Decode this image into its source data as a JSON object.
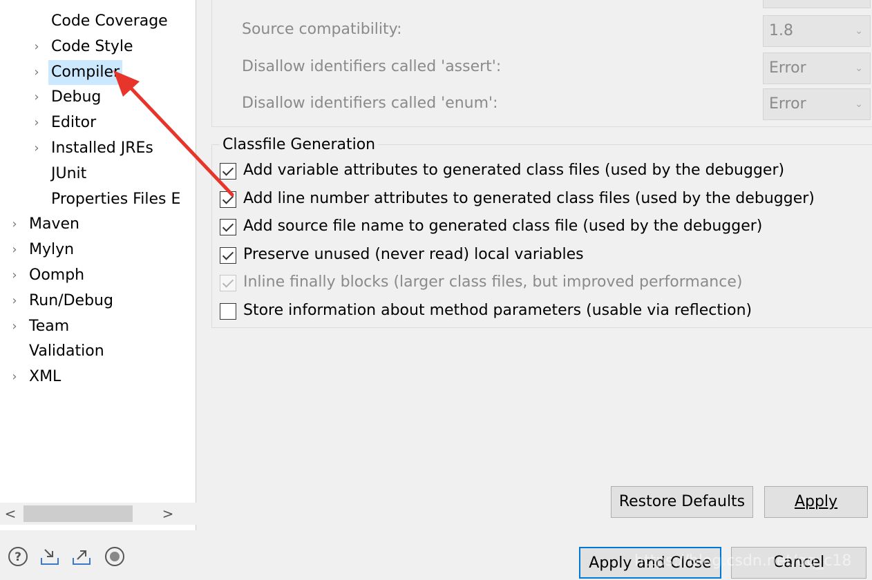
{
  "tree": {
    "items": [
      {
        "label": "Code Coverage",
        "chevron": false
      },
      {
        "label": "Code Style",
        "chevron": true
      },
      {
        "label": "Compiler",
        "chevron": true,
        "selected": true
      },
      {
        "label": "Debug",
        "chevron": true
      },
      {
        "label": "Editor",
        "chevron": true
      },
      {
        "label": "Installed JREs",
        "chevron": true
      },
      {
        "label": "JUnit",
        "chevron": false
      },
      {
        "label": "Properties Files E",
        "chevron": false
      },
      {
        "label": "Maven",
        "chevron": true
      },
      {
        "label": "Mylyn",
        "chevron": true
      },
      {
        "label": "Oomph",
        "chevron": true
      },
      {
        "label": "Run/Debug",
        "chevron": true
      },
      {
        "label": "Team",
        "chevron": true
      },
      {
        "label": "Validation",
        "chevron": false
      },
      {
        "label": "XML",
        "chevron": true
      }
    ],
    "scroll_left": "<",
    "scroll_right": ">"
  },
  "compliance": {
    "rows": [
      {
        "label": "Source compatibility:",
        "value": "1.8"
      },
      {
        "label": "Disallow identifiers called 'assert':",
        "value": "Error"
      },
      {
        "label": "Disallow identifiers called 'enum':",
        "value": "Error"
      }
    ]
  },
  "classfile": {
    "title": "Classfile Generation",
    "options": [
      {
        "label": "Add variable attributes to generated class files (used by the debugger)",
        "checked": true,
        "disabled": false
      },
      {
        "label": "Add line number attributes to generated class files (used by the debugger)",
        "checked": true,
        "disabled": false
      },
      {
        "label": "Add source file name to generated class file (used by the debugger)",
        "checked": true,
        "disabled": false
      },
      {
        "label": "Preserve unused (never read) local variables",
        "checked": true,
        "disabled": false
      },
      {
        "label": "Inline finally blocks (larger class files, but improved performance)",
        "checked": true,
        "disabled": true
      },
      {
        "label": "Store information about method parameters (usable via reflection)",
        "checked": false,
        "disabled": false
      }
    ]
  },
  "buttons": {
    "restore_defaults": "Restore Defaults",
    "apply": "Apply",
    "apply_and_close": "Apply and Close",
    "cancel": "Cancel"
  },
  "bottom_icons": [
    "help-icon",
    "import-icon",
    "export-icon",
    "record-icon"
  ],
  "watermark": "https://blog.csdn.net/qq_c18",
  "colors": {
    "selection": "#cce8ff",
    "arrow": "#e8352c",
    "focus": "#0078d7"
  }
}
